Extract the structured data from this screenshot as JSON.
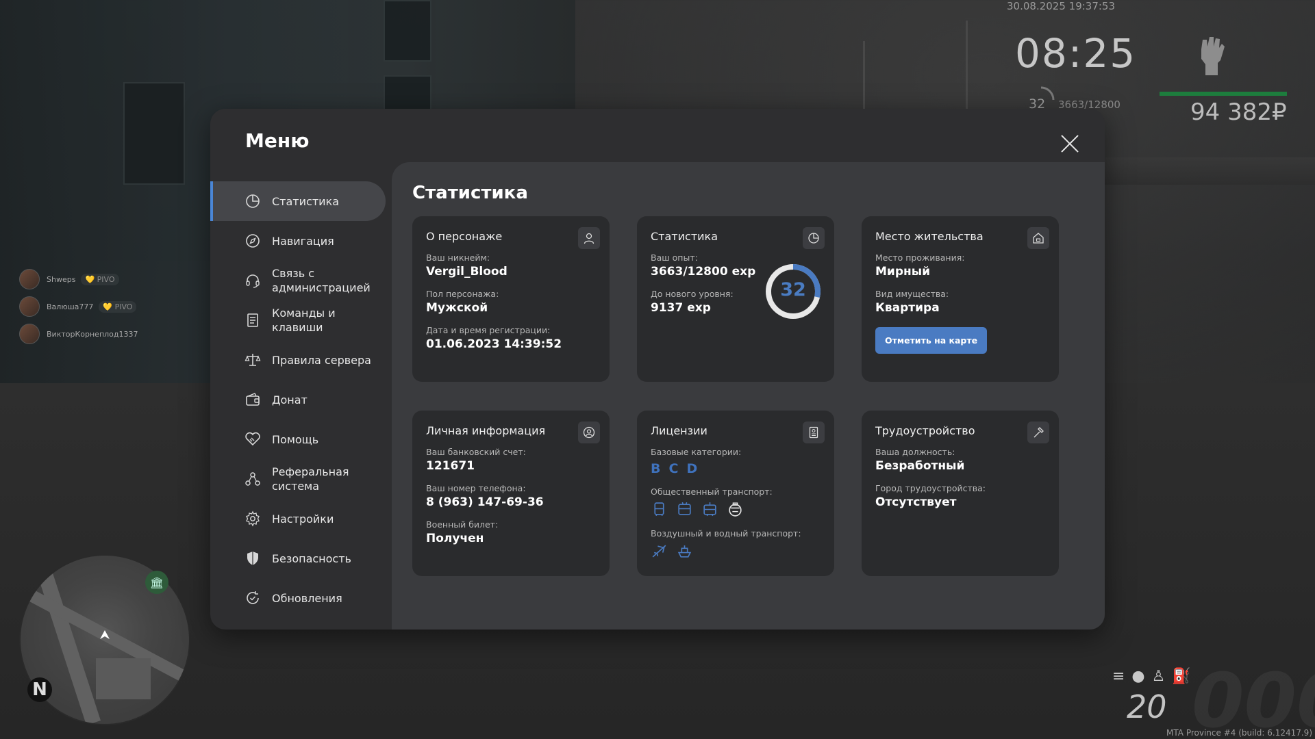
{
  "hud": {
    "datetime": "30.08.2025 19:37:53",
    "clock": "08:25",
    "level": "32",
    "exp": "3663/12800",
    "money": "94 382₽"
  },
  "chat": [
    {
      "name": "Shweps",
      "tag": "💛 PIVO"
    },
    {
      "name": "Валюша777",
      "tag": "💛 PIVO"
    },
    {
      "name": "ВикторКорнеплод1337",
      "tag": ""
    }
  ],
  "minimap": {
    "north": "N"
  },
  "vehicle": {
    "speed": "20"
  },
  "build": "MTA Province #4 (build: 6.12417.9)",
  "menu": {
    "title": "Меню",
    "sidebar": [
      {
        "label": "Статистика",
        "icon": "stats-icon",
        "active": true
      },
      {
        "label": "Навигация",
        "icon": "compass-icon"
      },
      {
        "label": "Связь с администрацией",
        "icon": "headset-icon"
      },
      {
        "label": "Команды и клавиши",
        "icon": "document-icon"
      },
      {
        "label": "Правила сервера",
        "icon": "scales-icon"
      },
      {
        "label": "Донат",
        "icon": "wallet-icon"
      },
      {
        "label": "Помощь",
        "icon": "handshake-icon"
      },
      {
        "label": "Реферальная система",
        "icon": "referral-icon"
      },
      {
        "label": "Настройки",
        "icon": "gear-icon"
      },
      {
        "label": "Безопасность",
        "icon": "shield-icon"
      },
      {
        "label": "Обновления",
        "icon": "refresh-check-icon"
      }
    ]
  },
  "content": {
    "title": "Статистика",
    "character": {
      "title": "О персонаже",
      "nickname_label": "Ваш никнейм:",
      "nickname": "Vergil_Blood",
      "gender_label": "Пол персонажа:",
      "gender": "Мужской",
      "reg_label": "Дата и время регистрации:",
      "reg": "01.06.2023 14:39:52"
    },
    "stats": {
      "title": "Статистика",
      "exp_label": "Ваш опыт:",
      "exp": "3663/12800 exp",
      "next_label": "До нового уровня:",
      "next": "9137 exp",
      "level": "32",
      "progress": 0.286
    },
    "residence": {
      "title": "Место жительства",
      "place_label": "Место проживания:",
      "place": "Мирный",
      "type_label": "Вид имущества:",
      "type": "Квартира",
      "button": "Отметить на карте"
    },
    "personal": {
      "title": "Личная информация",
      "bank_label": "Ваш банковский счет:",
      "bank": "121671",
      "phone_label": "Ваш номер телефона:",
      "phone": "8 (963) 147-69-36",
      "military_label": "Военный билет:",
      "military": "Получен"
    },
    "licenses": {
      "title": "Лицензии",
      "base_label": "Базовые категории:",
      "categories": [
        "B",
        "C",
        "D"
      ],
      "public_label": "Общественный транспорт:",
      "air_label": "Воздушный и водный транспорт:"
    },
    "job": {
      "title": "Трудоустройство",
      "position_label": "Ваша должность:",
      "position": "Безработный",
      "city_label": "Город трудоустройства:",
      "city": "Отсутствует"
    },
    "accent": "#4a7bc2"
  }
}
